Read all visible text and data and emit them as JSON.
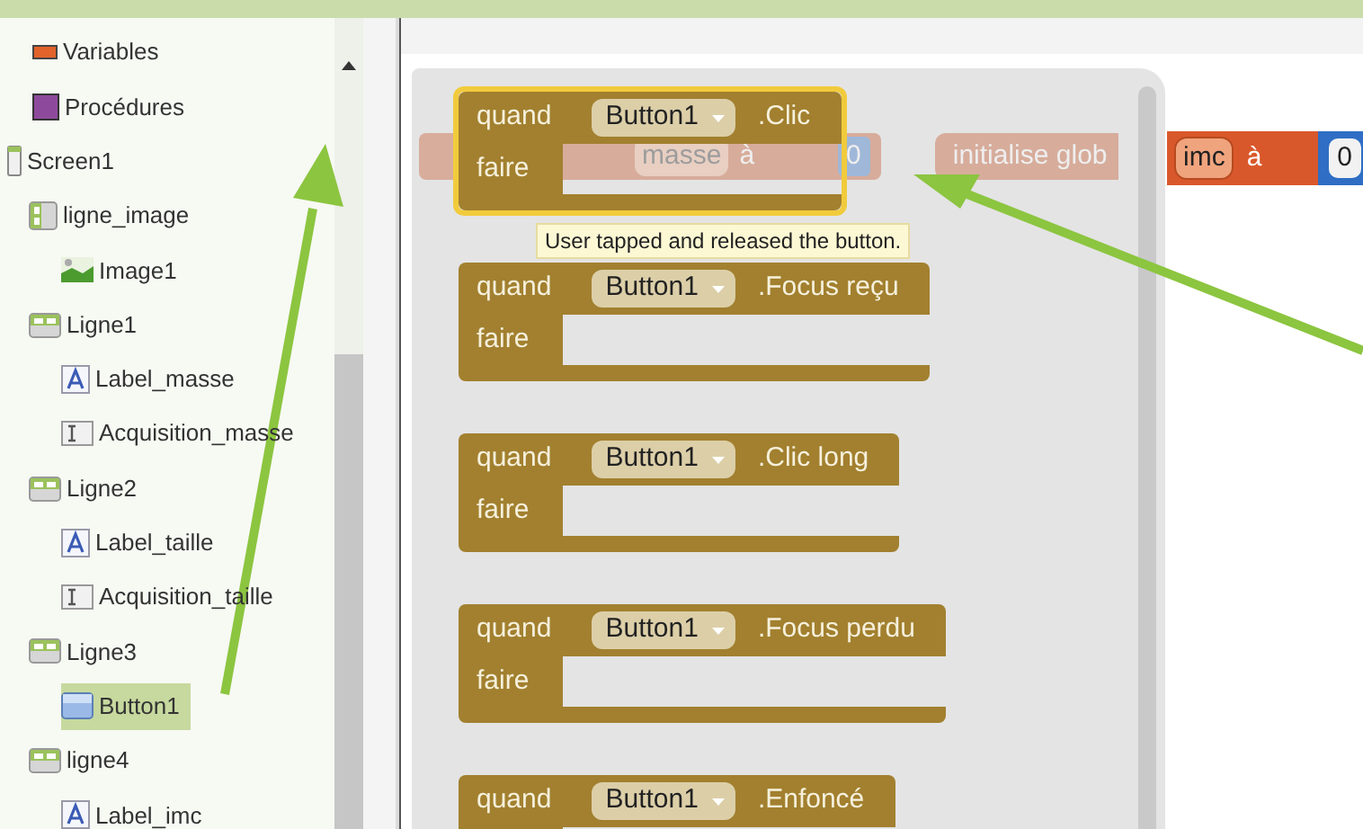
{
  "builtin_items": [
    {
      "label": "Variables",
      "kind": "variables"
    },
    {
      "label": "Procédures",
      "kind": "procedures"
    }
  ],
  "components": [
    {
      "label": "Screen1",
      "kind": "screen",
      "selected": false,
      "children": [
        {
          "label": "ligne_image",
          "kind": "vertical",
          "selected": false,
          "children": [
            {
              "label": "Image1",
              "kind": "image",
              "selected": false
            }
          ]
        },
        {
          "label": "Ligne1",
          "kind": "horizontal",
          "selected": false,
          "children": [
            {
              "label": "Label_masse",
              "kind": "label",
              "selected": false
            },
            {
              "label": "Acquisition_masse",
              "kind": "textbox",
              "selected": false
            }
          ]
        },
        {
          "label": "Ligne2",
          "kind": "horizontal",
          "selected": false,
          "children": [
            {
              "label": "Label_taille",
              "kind": "label",
              "selected": false
            },
            {
              "label": "Acquisition_taille",
              "kind": "textbox",
              "selected": false
            }
          ]
        },
        {
          "label": "Ligne3",
          "kind": "horizontal",
          "selected": false,
          "children": [
            {
              "label": "Button1",
              "kind": "button",
              "selected": true
            }
          ]
        },
        {
          "label": "ligne4",
          "kind": "horizontal",
          "selected": false,
          "children": [
            {
              "label": "Label_imc",
              "kind": "label",
              "selected": false
            }
          ]
        }
      ]
    }
  ],
  "faded_blocks": [
    {
      "name": "masse",
      "joiner": "à",
      "value": "0"
    },
    {
      "title": "initialise glob"
    }
  ],
  "workspace_block": {
    "name": "imc",
    "joiner": "à",
    "value": "0"
  },
  "event_blocks": [
    {
      "keyword": "quand",
      "component": "Button1",
      "event": ".Clic",
      "body_label": "faire",
      "selected": true,
      "tooltip": "User tapped and released the button."
    },
    {
      "keyword": "quand",
      "component": "Button1",
      "event": ".Focus reçu",
      "body_label": "faire",
      "selected": false
    },
    {
      "keyword": "quand",
      "component": "Button1",
      "event": ".Clic long",
      "body_label": "faire",
      "selected": false
    },
    {
      "keyword": "quand",
      "component": "Button1",
      "event": ".Focus perdu",
      "body_label": "faire",
      "selected": false
    },
    {
      "keyword": "quand",
      "component": "Button1",
      "event": ".Enfoncé",
      "selected": false
    }
  ]
}
